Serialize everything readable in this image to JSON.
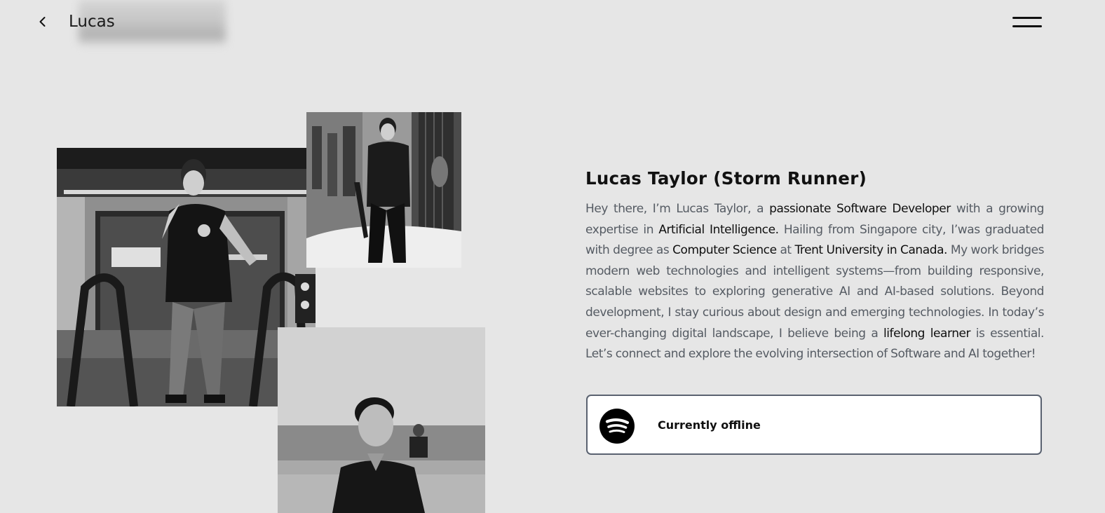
{
  "header": {
    "brand": "Lucas",
    "back_icon": "chevron-left-icon",
    "menu_icon": "hamburger-menu-icon"
  },
  "photos": [
    {
      "name": "photo-escalator",
      "description": "escalator-portrait"
    },
    {
      "name": "photo-street",
      "description": "snowy-street-portrait"
    },
    {
      "name": "photo-beach",
      "description": "beach-portrait"
    }
  ],
  "bio": {
    "title": "Lucas Taylor (Storm Runner)",
    "segments": {
      "t0": "Hey there, I’m Lucas Taylor, a ",
      "b0": "passionate Software Developer",
      "t1": " with a growing expertise in ",
      "b1": "Artificial Intelligence.",
      "t2": " Hailing from Singapore city, I’was graduated with degree as ",
      "b2": "Computer Science",
      "t3": " at ",
      "b3": "Trent University in Canada.",
      "t4": " My work bridges modern web technologies and intelligent systems—from building responsive, scalable websites to exploring generative AI and AI-based solutions. Beyond development, I stay curious about design and emerging technologies. In today’s ever-changing digital landscape, I believe being a ",
      "b4": "lifelong learner",
      "t5": " is essential. Let’s connect and explore the evolving intersection of Software and AI together!"
    }
  },
  "spotify": {
    "icon": "spotify-icon",
    "status": "Currently offline",
    "colors": {
      "border": "#5a6270",
      "icon": "#000000"
    }
  },
  "colors": {
    "background": "#e6e6e6",
    "text_muted": "#555b63",
    "text_strong": "#0f0f0f"
  }
}
